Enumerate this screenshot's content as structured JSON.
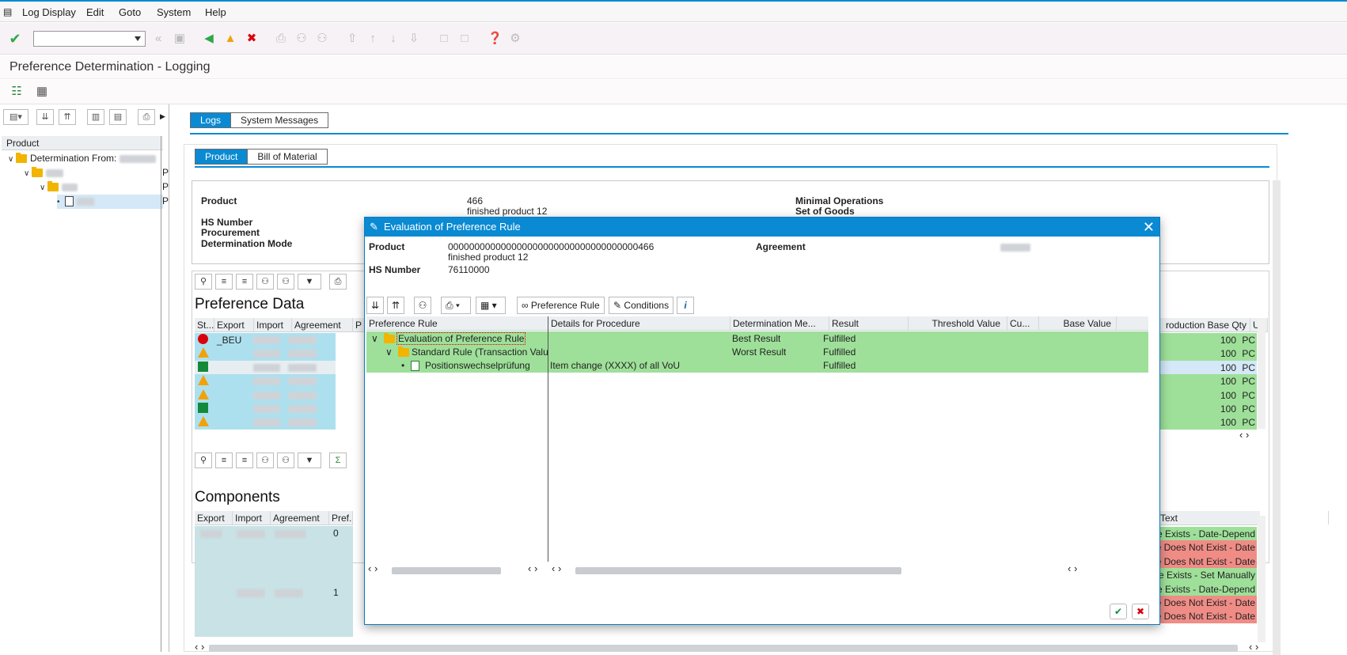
{
  "menu": [
    "Log Display",
    "Edit",
    "Goto",
    "System",
    "Help"
  ],
  "title": "Preference Determination - Logging",
  "left_tree": {
    "header": "Product",
    "root": "Determination From:",
    "p_labels": [
      "P",
      "P",
      "P"
    ]
  },
  "tabs_outer": [
    "Logs",
    "System Messages"
  ],
  "tabs_inner": [
    "Product",
    "Bill of Material"
  ],
  "header_info": {
    "product_label": "Product",
    "product_value": "466",
    "product_desc": "finished product 12",
    "hs_label": "HS Number",
    "procurement_label": "Procurement",
    "detmode_label": "Determination Mode",
    "minimal_ops": "Minimal Operations",
    "set_goods": "Set of Goods"
  },
  "pref_data": {
    "title": "Preference Data",
    "columns": [
      "St...",
      "Export",
      "Import",
      "Agreement",
      "P"
    ],
    "first_export": "_BEU",
    "right_header": "roduction Base Qty",
    "right_unit_header": "Ui",
    "qty": [
      "100",
      "100",
      "100",
      "100",
      "100",
      "100",
      "100"
    ],
    "unit": [
      "PC",
      "PC",
      "PC",
      "PC",
      "PC",
      "PC",
      "PC"
    ],
    "statuses": [
      "red",
      "triangle",
      "square",
      "triangle",
      "triangle",
      "square",
      "triangle"
    ]
  },
  "components": {
    "title": "Components",
    "columns": [
      "Export",
      "Import",
      "Agreement",
      "Pref.CM"
    ],
    "pref_values": [
      "0",
      "1"
    ],
    "text_header": "Text",
    "texts": [
      {
        "t": "e Exists - Date-Depend",
        "c": "green"
      },
      {
        "t": "e Does Not Exist - Date",
        "c": "red"
      },
      {
        "t": "e Does Not Exist - Date",
        "c": "red"
      },
      {
        "t": "e Exists - Set Manually",
        "c": "green"
      },
      {
        "t": "e Exists - Date-Depend",
        "c": "green"
      },
      {
        "t": "e Does Not Exist - Date",
        "c": "red"
      },
      {
        "t": "e Does Not Exist - Date",
        "c": "red"
      }
    ]
  },
  "dialog": {
    "title": "Evaluation of Preference Rule",
    "product_label": "Product",
    "product_value": "000000000000000000000000000000000000466",
    "product_desc": "finished product 12",
    "hs_label": "HS Number",
    "hs_value": "76110000",
    "agreement_label": "Agreement",
    "btn_pref_rule": "Preference Rule",
    "btn_conditions": "Conditions",
    "columns": [
      "Preference Rule",
      "Details for Procedure",
      "Determination Me...",
      "Result",
      "Threshold Value",
      "Cu...",
      "Base Value"
    ],
    "rows": [
      {
        "rule": "Evaluation of Preference Rule",
        "details": "",
        "mode": "Best Result",
        "result": "Fulfilled"
      },
      {
        "rule": "Standard Rule (Transaction Value M",
        "details": "",
        "mode": "Worst Result",
        "result": "Fulfilled"
      },
      {
        "rule": "Positionswechselprüfung",
        "details": "Item change (XXXX) of all VoU",
        "mode": "",
        "result": "Fulfilled"
      }
    ]
  },
  "colors": {
    "accent": "#0a8ad2",
    "green": "#9ee099",
    "red": "#f08c86",
    "rowblue": "#ade0ef"
  }
}
